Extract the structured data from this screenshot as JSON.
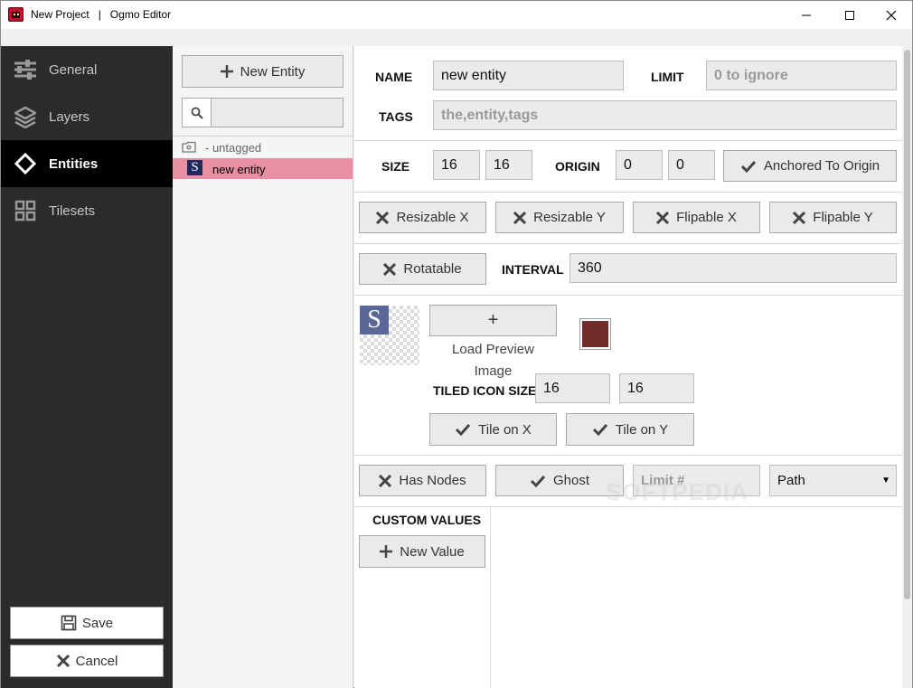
{
  "window": {
    "title": "New Project   |   Ogmo Editor",
    "controls": {
      "minimize": "—",
      "maximize": "☐",
      "close": "✕"
    }
  },
  "sidebar": {
    "items": [
      {
        "label": "General",
        "icon": "sliders-icon",
        "active": false
      },
      {
        "label": "Layers",
        "icon": "layers-icon",
        "active": false
      },
      {
        "label": "Entities",
        "icon": "diamond-icon",
        "active": true
      },
      {
        "label": "Tilesets",
        "icon": "grid-icon",
        "active": false
      }
    ],
    "save_label": "Save",
    "cancel_label": "Cancel"
  },
  "entity_list": {
    "new_entity_label": "New Entity",
    "search_value": "",
    "tag_group": "- untagged",
    "entities": [
      {
        "badge": "S",
        "name": "new entity",
        "selected": true
      }
    ]
  },
  "form": {
    "name_label": "NAME",
    "name_value": "new entity",
    "limit_label": "LIMIT",
    "limit_placeholder": "0 to ignore",
    "tags_label": "TAGS",
    "tags_placeholder": "the,entity,tags",
    "size_label": "SIZE",
    "size_x": "16",
    "size_y": "16",
    "origin_label": "ORIGIN",
    "origin_x": "0",
    "origin_y": "0",
    "anchored_label": "Anchored To Origin",
    "resizable_x_label": "Resizable X",
    "resizable_y_label": "Resizable Y",
    "flipable_x_label": "Flipable X",
    "flipable_y_label": "Flipable Y",
    "rotatable_label": "Rotatable",
    "interval_label": "INTERVAL",
    "interval_value": "360",
    "preview_badge": "S",
    "load_preview_plus": "+",
    "load_preview_line1": "Load Preview",
    "load_preview_line2": "Image",
    "entity_color": "#722c2c",
    "tiled_icon_size_label": "TILED ICON SIZE",
    "tiled_x": "16",
    "tiled_y": "16",
    "tile_on_x_label": "Tile on X",
    "tile_on_y_label": "Tile on Y",
    "has_nodes_label": "Has Nodes",
    "ghost_label": "Ghost",
    "node_limit_placeholder": "Limit #",
    "node_display_value": "Path",
    "custom_values_label": "CUSTOM VALUES",
    "new_value_label": "New Value"
  },
  "watermark": "SOFTPEDIA"
}
